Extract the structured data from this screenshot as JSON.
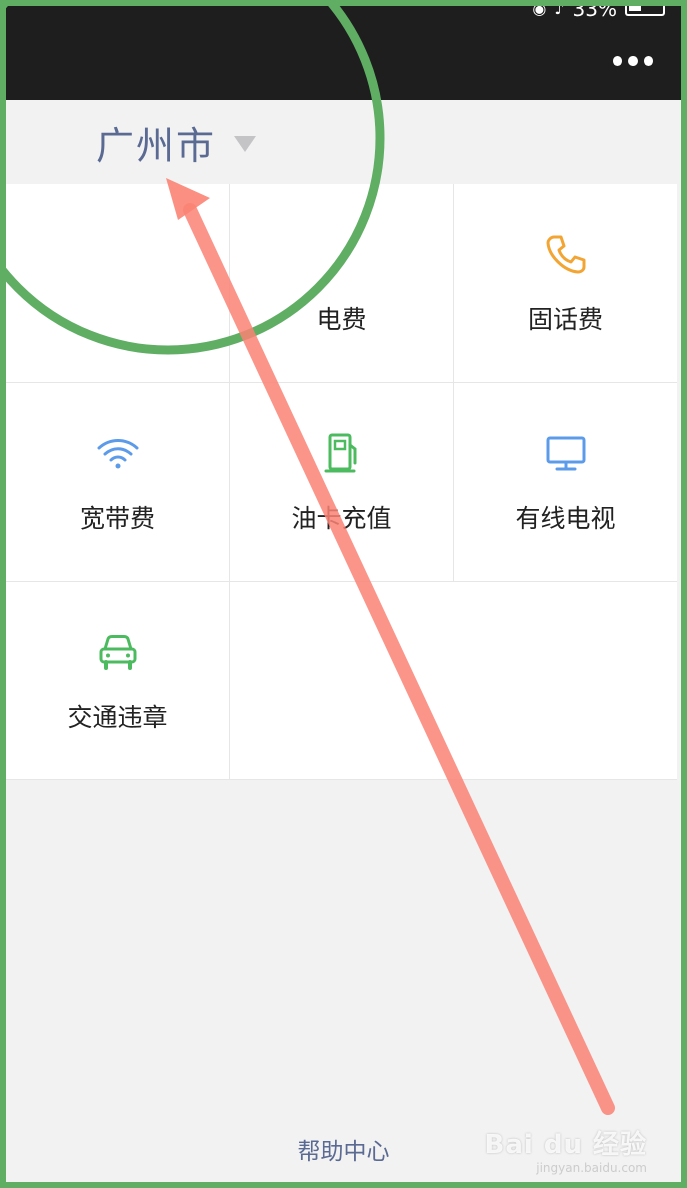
{
  "status_bar": {
    "battery_level": "33%",
    "icons": [
      "headset-icon",
      "music-note-icon",
      "battery-icon"
    ]
  },
  "header": {
    "more_icon": "more-dots-icon"
  },
  "city": {
    "name": "广州市",
    "dropdown_icon": "triangle-down-icon"
  },
  "services": [
    {
      "label": "",
      "icon": "hidden-icon"
    },
    {
      "label": "电费",
      "icon": "hidden-icon"
    },
    {
      "label": "固话费",
      "icon": "phone-icon",
      "color": "#f2a533"
    },
    {
      "label": "宽带费",
      "icon": "wifi-icon",
      "color": "#5b9bea"
    },
    {
      "label": "油卡充值",
      "icon": "fuel-pump-icon",
      "color": "#4cbb5f"
    },
    {
      "label": "有线电视",
      "icon": "tv-monitor-icon",
      "color": "#5b9bea"
    },
    {
      "label": "交通违章",
      "icon": "car-icon",
      "color": "#4cbb5f"
    }
  ],
  "footer": {
    "help_label": "帮助中心"
  },
  "annotation": {
    "circle_color": "#5fae64",
    "arrow_color": "#fa8374",
    "frame_color": "#5fae64"
  },
  "watermark": {
    "main": "Bai du 经验",
    "sub": "jingyan.baidu.com"
  }
}
